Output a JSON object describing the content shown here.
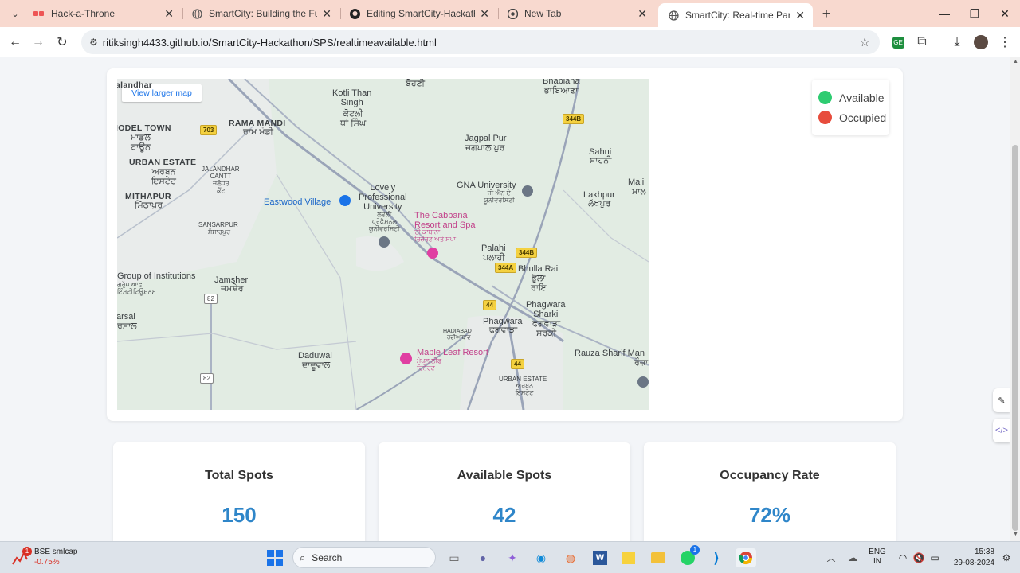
{
  "browser": {
    "tabs": [
      {
        "title": "Hack-a-Throne",
        "icon": "hackathon-favicon-icon",
        "active": false
      },
      {
        "title": "SmartCity: Building the Future",
        "icon": "globe-icon",
        "active": false
      },
      {
        "title": "Editing SmartCity-Hackathon/R",
        "icon": "github-icon",
        "active": false
      },
      {
        "title": "New Tab",
        "icon": "chrome-icon",
        "active": false
      },
      {
        "title": "SmartCity: Real-time Parking Av",
        "icon": "globe-icon",
        "active": true
      }
    ],
    "url": "ritiksingh4433.github.io/SmartCity-Hackathon/SPS/realtimeavailable.html"
  },
  "map": {
    "view_larger": "View larger map",
    "labels": {
      "jalandhar": "alandhar",
      "model_town": "IODEL TOWN",
      "model_town_pa": "ਮਾਡਲ\nਟਾਊਨ",
      "urban_estate": "URBAN ESTATE",
      "urban_estate_pa": "ਅਰਬਨ\nਇਸਟੇਟ",
      "mithapur": "MITHAPUR",
      "mithapur_pa": "ਮਿੱਠਾਪੁਰ",
      "rama_mandi": "RAMA MANDI",
      "rama_mandi_pa": "ਰਾਮ ਮੰਡੀ",
      "jalandhar_cantt": "JALANDHAR\nCANTT",
      "jalandhar_cantt_pa": "ਜਲੰਧਰ\nਕੈਂਟ",
      "sansarpur": "SANSARPUR",
      "sansarpur_pa": "ਸੰਸਾਰਪੁਰ",
      "kotli": "Kotli Than\nSingh",
      "kotli_pa": "ਕੋਟਲੀ\nਥਾਂ ਸਿੰਘ",
      "eastwood": "Eastwood Village",
      "lpu": "Lovely\nProfessional\nUniversity",
      "lpu_pa": "ਲਵਲੀ\nਪ੍ਰੋਫੈਸ਼ਨਲ\nਯੂਨੀਵਰਸਿਟੀ",
      "cabbana": "The Cabbana\nResort and Spa",
      "cabbana_pa": "ਦੀ ਕਾਬਾਨਾ\nਰਿਜ਼ੌਰਟ ਅਤੇ ਸਪਾ",
      "jagpal": "Jagpal Pur",
      "jagpal_pa": "ਜਗਪਾਲ ਪੁਰ",
      "gna": "GNA University",
      "gna_pa": "ਜੀ ਐਨ ਏ\nਯੂਨੀਵਰਸਿਟੀ",
      "bhabiana": "Bhabiana",
      "bhabiana_pa": "ਭਾਬਿਆਣਾ",
      "boheri": "ਬੋਹਣੀ",
      "sahni": "Sahni",
      "sahni_pa": "ਸਾਹਨੀ",
      "lakhpur": "Lakhpur",
      "lakhpur_pa": "ਲੱਖਪੁਰ",
      "mali": "Mali",
      "mali_pa": "ਮਾਲ",
      "palahi": "Palahi",
      "palahi_pa": "ਪਲਾਹੀ",
      "bhulla_rai": "Bhulla Rai",
      "bhulla_rai_pa": "ਭੁੱਲਾ\nਰਾਇ",
      "phagwara_sharki": "Phagwara\nSharki",
      "phagwara_sharki_pa": "ਫਗਵਾੜਾ\nਸ਼ਰਕੀ",
      "phagwara": "Phagwara",
      "phagwara_pa": "ਫਗਵਾੜਾ",
      "hadiabad": "HADIABAD",
      "hadiabad_pa": "ਹਦੀਆਬਾਦ",
      "group_inst": "Group of Institutions",
      "group_inst_pa": "ਗਰੁੱਪ ਆਫ\nਇੰਸਟੀਟਿਊਸ਼ਨਸ",
      "jamsher": "Jamsher",
      "jamsher_pa": "ਜਮਸ਼ੇਰ",
      "arsal": "arsal",
      "arsal_pa": "ਰਸਾਲ",
      "daduwal": "Daduwal",
      "daduwal_pa": "ਦਾਦੂਵਾਲ",
      "maple": "Maple Leaf Resort",
      "maple_pa": "ਮੇਪਲ ਲੀਫ\nਰਿਜ਼ੌਰਟ",
      "urban_estate2": "URBAN ESTATE",
      "urban_estate2_pa": "ਅਰਬਨ\nਇਸਟੇਟ",
      "rauza": "Rauza Sharif Man",
      "rauza_pa": "ਰੌਜ਼ਾ"
    },
    "highways": {
      "h703": "703",
      "h344b_1": "344B",
      "h344b_2": "344B",
      "h344a": "344A",
      "h44_1": "44",
      "h44_2": "44",
      "h82_1": "82",
      "h82_2": "82"
    }
  },
  "legend": {
    "available": {
      "label": "Available",
      "color": "#2ecc71"
    },
    "occupied": {
      "label": "Occupied",
      "color": "#e74c3c"
    }
  },
  "stats": {
    "total": {
      "title": "Total Spots",
      "value": "150"
    },
    "available": {
      "title": "Available Spots",
      "value": "42"
    },
    "occupancy": {
      "title": "Occupancy Rate",
      "value": "72%"
    }
  },
  "taskbar": {
    "ticker_name": "BSE smlcap",
    "ticker_change": "-0.75%",
    "ticker_badge": "1",
    "search_placeholder": "Search",
    "whatsapp_badge": "1",
    "lang_top": "ENG",
    "lang_bottom": "IN",
    "time": "15:38",
    "date": "29-08-2024"
  }
}
